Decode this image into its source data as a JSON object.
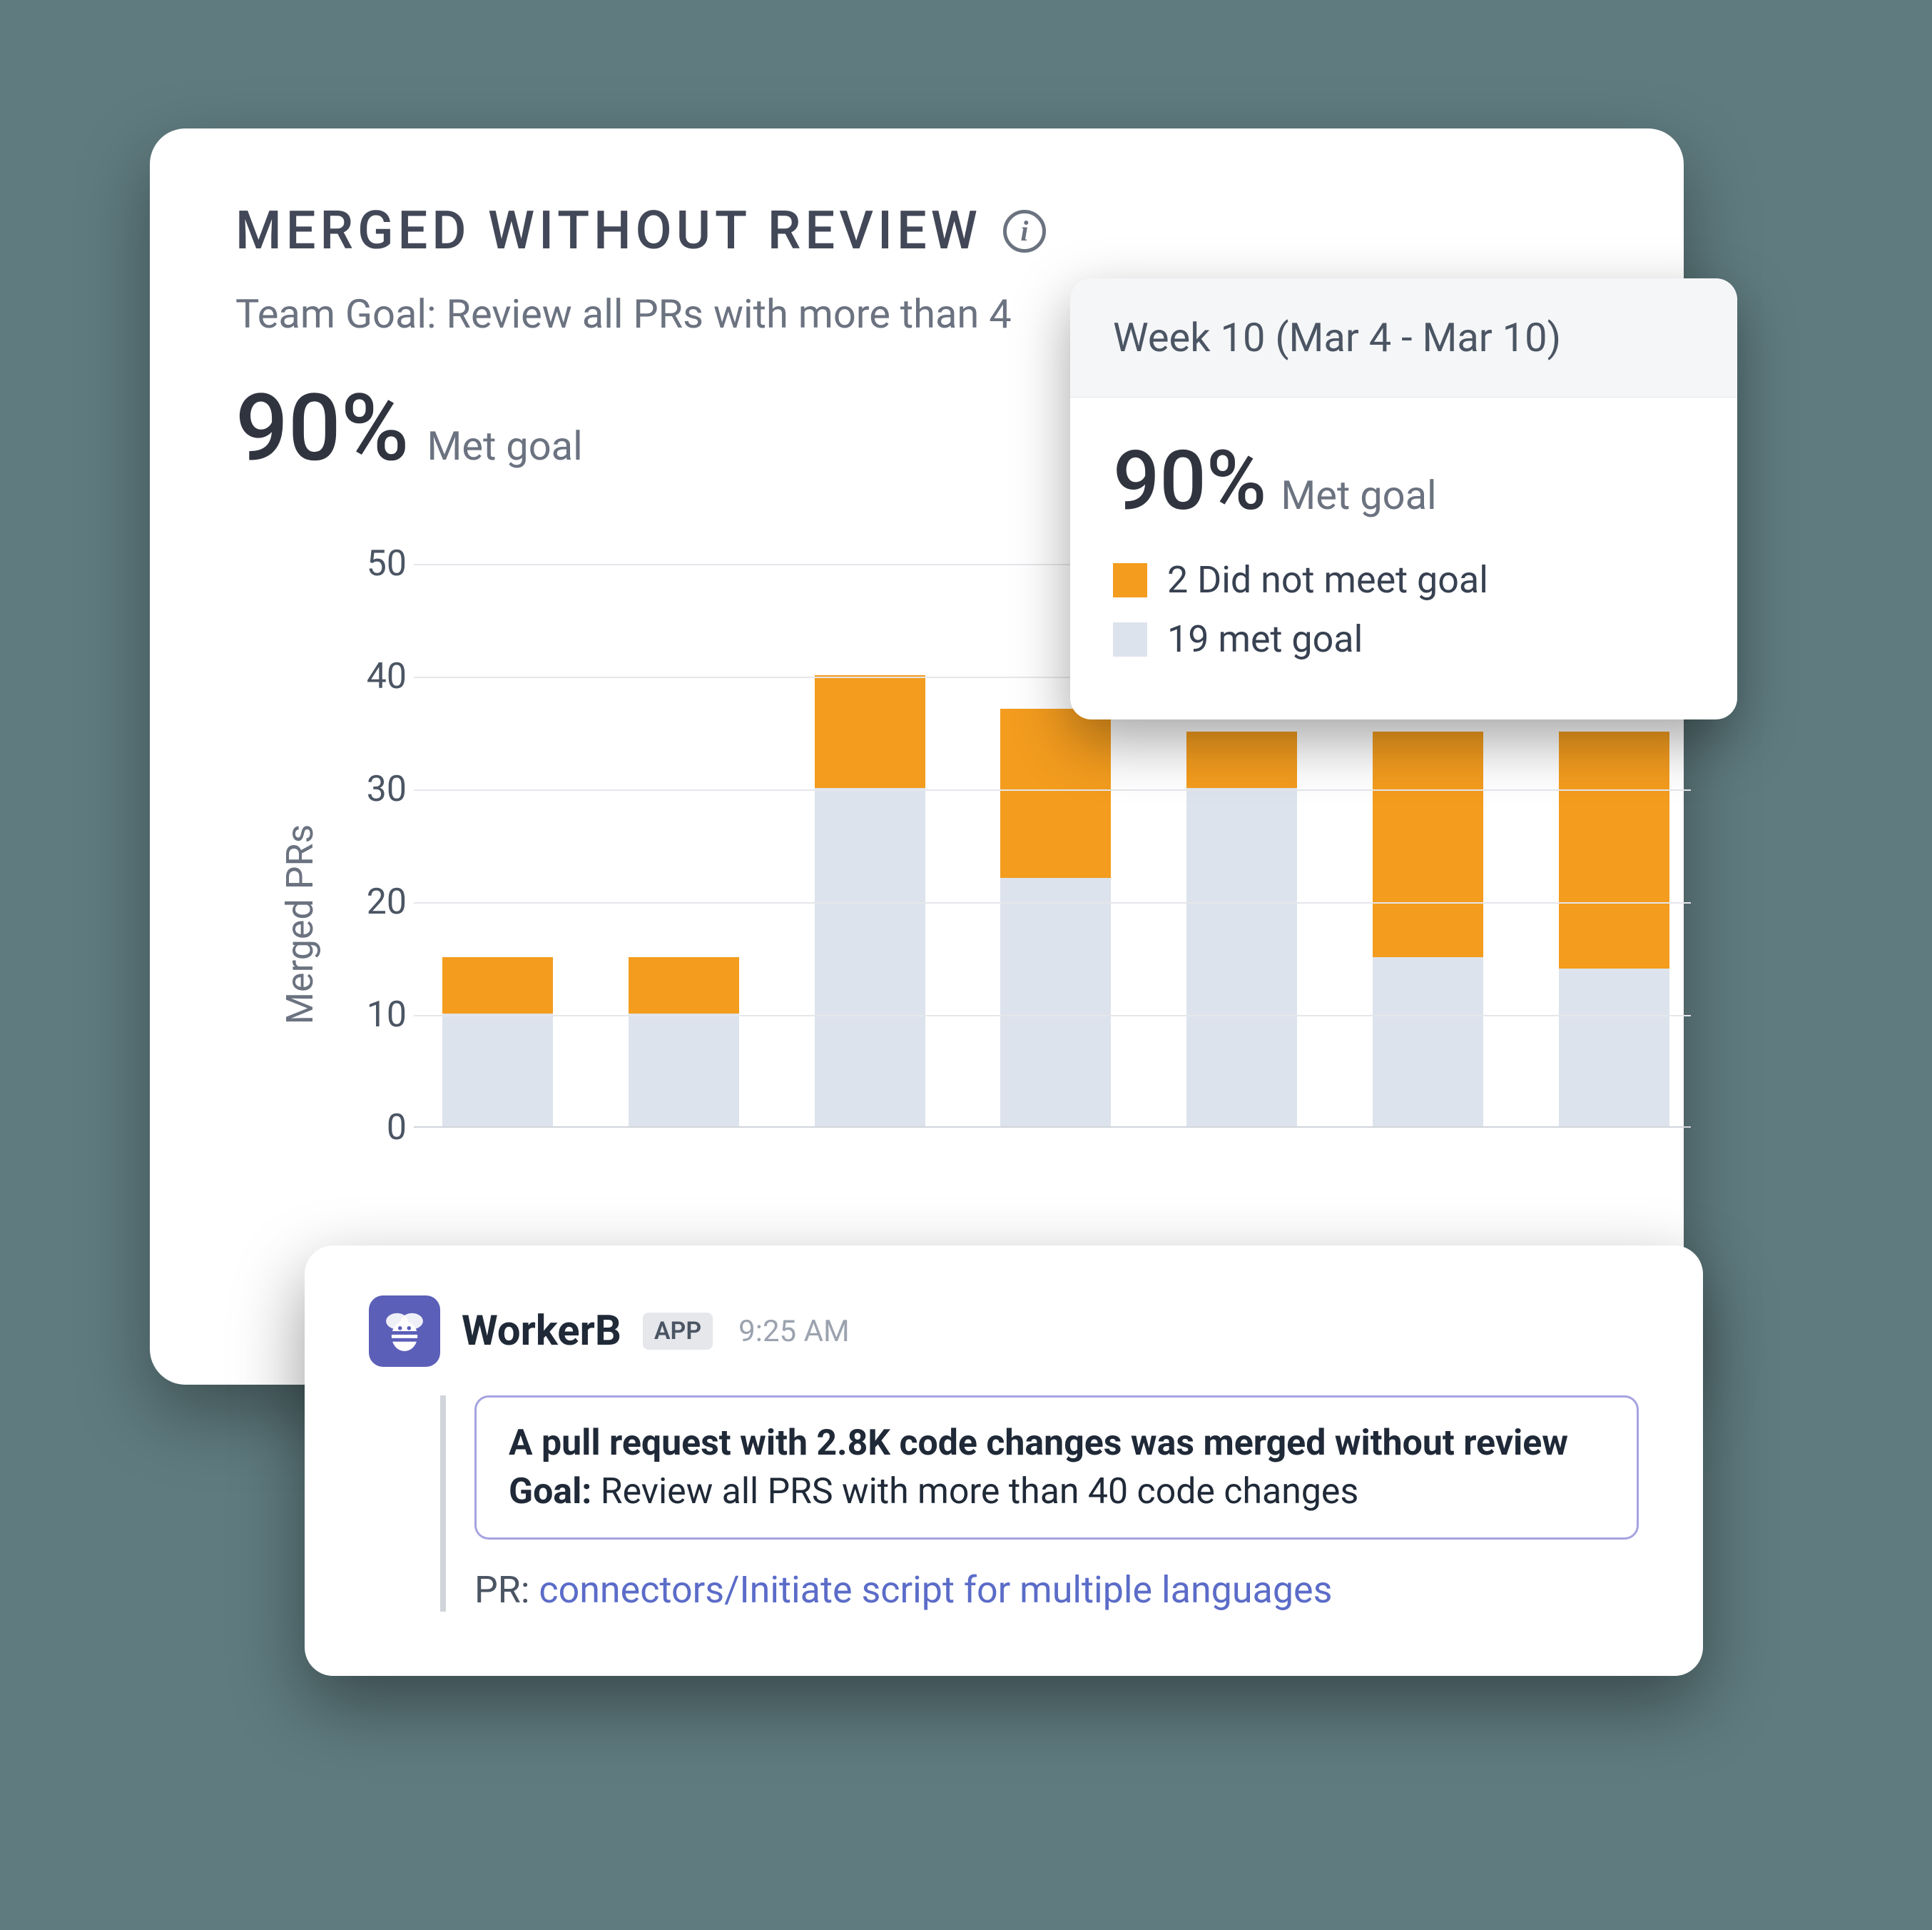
{
  "main": {
    "title": "MERGED WITHOUT REVIEW",
    "subtitle": "Team Goal: Review all PRs with more than 4",
    "metric_pct": "90%",
    "metric_label": "Met goal"
  },
  "chart_data": {
    "type": "bar",
    "ylabel": "Merged PRs",
    "ylim": [
      0,
      50
    ],
    "yticks": [
      0,
      10,
      20,
      30,
      40,
      50
    ],
    "categories": [
      "",
      "",
      "",
      "",
      "",
      "",
      ""
    ],
    "series": [
      {
        "name": "met goal",
        "color": "#dde3ec",
        "values": [
          10,
          10,
          30,
          22,
          30,
          15,
          14
        ]
      },
      {
        "name": "did not meet goal",
        "color": "#f39c1e",
        "values": [
          5,
          5,
          10,
          15,
          5,
          20,
          21
        ]
      }
    ]
  },
  "tooltip": {
    "header": "Week 10 (Mar 4 - Mar 10)",
    "pct": "90%",
    "met_label": "Met goal",
    "not_met_text": "2 Did not meet goal",
    "met_text": "19 met goal"
  },
  "notification": {
    "app_name": "WorkerB",
    "badge": "APP",
    "timestamp": "9:25 AM",
    "notice_line1": "A pull request with 2.8K code changes was merged without review",
    "goal_label": "Goal:",
    "goal_text": " Review all PRS with more than 40 code changes",
    "pr_prefix": "PR: ",
    "pr_link": "connectors/Initiate script for multiple languages"
  }
}
